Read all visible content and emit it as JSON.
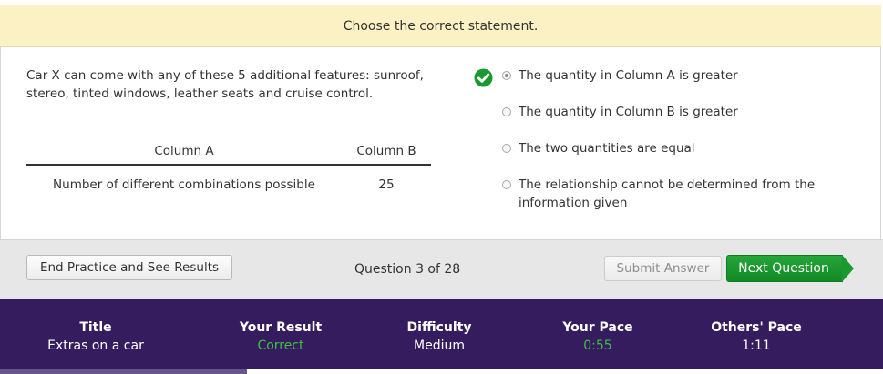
{
  "prompt": "Choose the correct statement.",
  "question": {
    "stem": "Car X can come with any of these 5 additional features: sunroof, stereo, tinted windows, leather seats and cruise control.",
    "table": {
      "headers": [
        "Column A",
        "Column B"
      ],
      "row": [
        "Number of different combinations possible",
        "25"
      ]
    }
  },
  "choices": [
    {
      "label": "The quantity in Column A is greater",
      "selected": true,
      "correct": true
    },
    {
      "label": "The quantity in Column B is greater",
      "selected": false
    },
    {
      "label": "The two quantities are equal",
      "selected": false
    },
    {
      "label": "The relationship cannot be determined from the information given",
      "selected": false
    }
  ],
  "icons": {
    "correct_marker": "check-circle-icon"
  },
  "footer": {
    "end_button": "End Practice and See Results",
    "counter": "Question 3 of 28",
    "submit_button": "Submit Answer",
    "next_button": "Next Question"
  },
  "stats": [
    {
      "label": "Title",
      "value": "Extras on a car"
    },
    {
      "label": "Your Result",
      "value": "Correct",
      "status": "good"
    },
    {
      "label": "Difficulty",
      "value": "Medium"
    },
    {
      "label": "Your Pace",
      "value": "0:55",
      "status": "good"
    },
    {
      "label": "Others' Pace",
      "value": "1:11"
    }
  ],
  "progress_fraction": 0.28,
  "colors": {
    "prompt_bg": "#fcf1c4",
    "accent_green": "#1a9a2e",
    "stats_bg": "#351c5f",
    "good_text": "#3fbf3f"
  }
}
